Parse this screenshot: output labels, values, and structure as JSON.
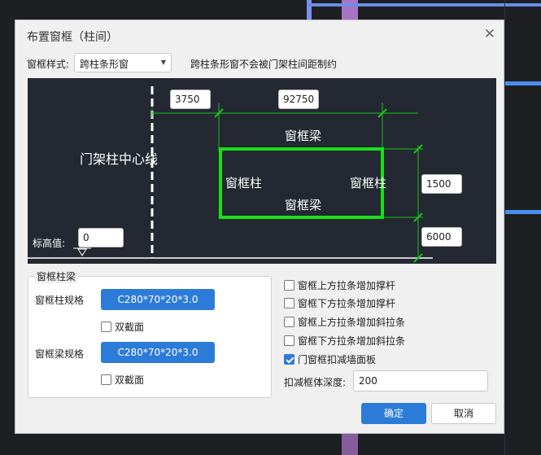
{
  "dialog": {
    "title": "布置窗框（柱间）",
    "close_glyph": "✕",
    "style_label": "窗框样式:",
    "style_value": "跨柱条形窗",
    "style_note": "跨柱条形窗不会被门架柱间距制约"
  },
  "canvas": {
    "dim_left": "3750",
    "dim_top": "92750",
    "dim_height": "1500",
    "dim_bottom": "6000",
    "elev_label": "标高值:",
    "elev_value": "0",
    "centerline_label": "门架柱中心线",
    "beam_top": "窗框梁",
    "beam_bottom": "窗框梁",
    "col_left": "窗框柱",
    "col_right": "窗框柱",
    "colors": {
      "frame": "#18e018",
      "dim": "#19c219",
      "background": "#232833"
    }
  },
  "beam_group": {
    "title": "窗框柱梁",
    "col_spec_label": "窗框柱规格",
    "col_spec_value": "C280*70*20*3.0",
    "col_double_label": "双截面",
    "beam_spec_label": "窗框梁规格",
    "beam_spec_value": "C280*70*20*3.0",
    "beam_double_label": "双截面"
  },
  "options": {
    "opt1": "窗框上方拉条增加撑杆",
    "opt2": "窗框下方拉条增加撑杆",
    "opt3": "窗框上方拉条增加斜拉条",
    "opt4": "窗框下方拉条增加斜拉条",
    "opt5": "门窗框扣减墙面板",
    "depth_label": "扣减框体深度:",
    "depth_value": "200"
  },
  "buttons": {
    "ok": "确定",
    "cancel": "取消"
  },
  "accent": "#2d7bd8"
}
